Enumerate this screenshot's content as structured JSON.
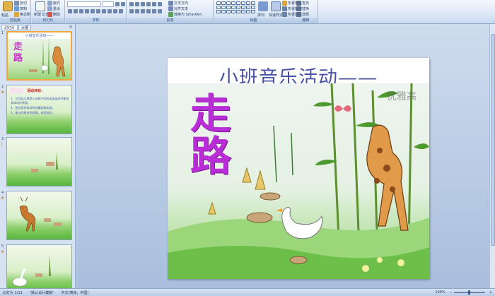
{
  "ribbon": {
    "clipboard": {
      "paste": "粘贴",
      "cut": "剪切",
      "copy": "复制",
      "format_painter": "格式刷",
      "group": "剪贴板"
    },
    "slides": {
      "new_slide": "新建\n幻灯片",
      "layout": "版式",
      "reset": "重设",
      "delete": "删除",
      "group": "幻灯片"
    },
    "font": {
      "group": "字体"
    },
    "paragraph": {
      "text_direction": "文字方向",
      "align_text": "对齐文本",
      "smartart": "转换为 SmartArt",
      "group": "段落"
    },
    "drawing": {
      "arrange": "排列",
      "quick_styles": "快速样式",
      "fill": "形状填充",
      "outline": "形状轮廓",
      "effects": "形状效果",
      "group": "绘图"
    },
    "editing": {
      "find": "查找",
      "replace": "替换",
      "select": "选择",
      "group": "编辑"
    }
  },
  "panel": {
    "tabs": [
      "幻灯片",
      "大纲"
    ],
    "close": "×",
    "thumbs": [
      {
        "num": "1",
        "title": "小班音乐活动——",
        "chars": [
          "走",
          "路"
        ]
      },
      {
        "num": "2",
        "label": "活动目标：",
        "lines": [
          "1、引导幼儿感受小动物不同的走路姿态并能用身体动作表现。",
          "2、尝试用身体动作创编动物走路。",
          "3、能与同伴合作表演，体验快乐。"
        ]
      },
      {
        "num": "3"
      },
      {
        "num": "4"
      },
      {
        "num": "5"
      }
    ]
  },
  "slide": {
    "title": "小班音乐活动——",
    "chars": [
      "走",
      "路"
    ],
    "watermark": "优雅高"
  },
  "status": {
    "slide_count": "幻灯片 1/11",
    "theme": "\"默认设计模板\"",
    "language": "中文(简体，中国)",
    "zoom": "100%"
  },
  "colors": {
    "accent": "#4752a4",
    "char": "#b92dd6",
    "selected": "#f3a73c"
  }
}
